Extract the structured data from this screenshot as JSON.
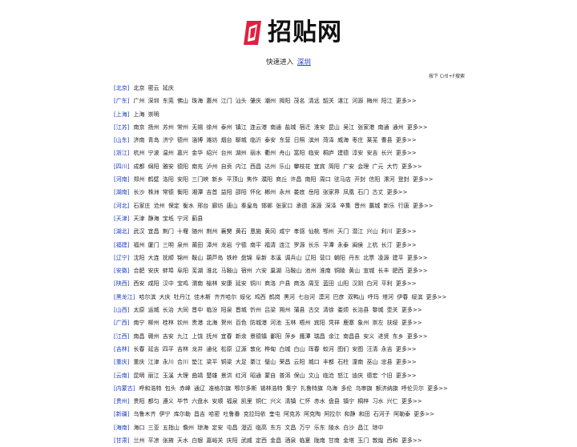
{
  "logo": {
    "text": "招贴网"
  },
  "quick": {
    "label": "快速进入",
    "city": "深圳"
  },
  "hint": "按下 Crtl+F搜索",
  "more": "更多>>",
  "regions": [
    {
      "name": "[北京]",
      "cities": [
        "北京",
        "密云",
        "延庆"
      ],
      "more": false
    },
    {
      "name": "[广东]",
      "cities": [
        "广州",
        "深圳",
        "东莞",
        "佛山",
        "珠海",
        "惠州",
        "江门",
        "汕头",
        "肇庆",
        "潮州",
        "揭阳",
        "茂名",
        "清远",
        "韶关",
        "湛江",
        "河源",
        "梅州",
        "阳江"
      ],
      "more": true
    },
    {
      "name": "[上海]",
      "cities": [
        "上海",
        "崇明"
      ],
      "more": false
    },
    {
      "name": "[江苏]",
      "cities": [
        "南京",
        "扬州",
        "苏州",
        "常州",
        "无锡",
        "徐州",
        "泰州",
        "镇江",
        "连云港",
        "南通",
        "盐城",
        "宿迁",
        "淮安",
        "昆山",
        "吴江",
        "张家港",
        "南通",
        "通州"
      ],
      "more": true
    },
    {
      "name": "[山东]",
      "cities": [
        "济南",
        "青岛",
        "济宁",
        "德州",
        "淄博",
        "潍坊",
        "烟台",
        "聊城",
        "临沂",
        "泰安",
        "东营",
        "日照",
        "滨州",
        "菏泽",
        "威海",
        "枣庄",
        "莱芜",
        "曹县"
      ],
      "more": true
    },
    {
      "name": "[浙江]",
      "cities": [
        "杭州",
        "宁波",
        "温州",
        "嘉兴",
        "金华",
        "绍兴",
        "台州",
        "湖州",
        "丽水",
        "衢州",
        "舟山",
        "富阳",
        "临安",
        "桐庐",
        "建德",
        "淳安",
        "安吉",
        "长兴"
      ],
      "more": true
    },
    {
      "name": "[四川]",
      "cities": [
        "成都",
        "绵阳",
        "雅安",
        "德阳",
        "南充",
        "泸州",
        "自贡",
        "内江",
        "西昌",
        "达州",
        "乐山",
        "攀枝花",
        "宜宾",
        "简阳",
        "广安",
        "会理",
        "广元",
        "大竹"
      ],
      "more": true
    },
    {
      "name": "[河南]",
      "cities": [
        "郑州",
        "鹤壁",
        "洛阳",
        "安阳",
        "三门峡",
        "新乡",
        "平顶山",
        "焦作",
        "濮阳",
        "商丘",
        "许昌",
        "南阳",
        "周口",
        "驻马店",
        "开封",
        "信阳",
        "漯河",
        "登封"
      ],
      "more": true
    },
    {
      "name": "[湖南]",
      "cities": [
        "长沙",
        "株洲",
        "常德",
        "衡阳",
        "湘潭",
        "吉首",
        "益阳",
        "邵阳",
        "怀化",
        "郴州",
        "永州",
        "娄底",
        "岳阳",
        "张家界",
        "凤凰",
        "石门",
        "古丈"
      ],
      "more": true
    },
    {
      "name": "[河北]",
      "cities": [
        "石家庄",
        "沧州",
        "保定",
        "衡水",
        "邢台",
        "廊坊",
        "唐山",
        "秦皇岛",
        "邯郸",
        "张家口",
        "承德",
        "涿源",
        "深泽",
        "辛集",
        "晋州",
        "藁城",
        "新乐",
        "行唐"
      ],
      "more": true
    },
    {
      "name": "[天津]",
      "cities": [
        "天津",
        "静海",
        "宝坻",
        "宁河",
        "蓟县"
      ],
      "more": false
    },
    {
      "name": "[湖北]",
      "cities": [
        "武汉",
        "宜昌",
        "荆门",
        "十堰",
        "随州",
        "荆州",
        "襄樊",
        "黄石",
        "恩施",
        "黄冈",
        "咸宁",
        "孝感",
        "仙桃",
        "鄂州",
        "天门",
        "潜江",
        "兴山",
        "利川"
      ],
      "more": true
    },
    {
      "name": "[福建]",
      "cities": [
        "福州",
        "厦门",
        "三明",
        "泉州",
        "莆田",
        "漳州",
        "龙岩",
        "宁德",
        "南平",
        "福清",
        "连江",
        "罗源",
        "长乐",
        "平潭",
        "永泰",
        "闽侯",
        "上杭",
        "长汀"
      ],
      "more": true
    },
    {
      "name": "[辽宁]",
      "cities": [
        "沈阳",
        "大连",
        "抚顺",
        "锦州",
        "鞍山",
        "葫芦岛",
        "铁岭",
        "盘锦",
        "阜新",
        "本溪",
        "调兵山",
        "辽阳",
        "营口",
        "朝阳",
        "丹东",
        "北票",
        "凌源",
        "建平"
      ],
      "more": true
    },
    {
      "name": "[安徽]",
      "cities": [
        "合肥",
        "安庆",
        "蚌埠",
        "阜阳",
        "芜湖",
        "淮北",
        "马鞍山",
        "宿州",
        "六安",
        "巢湖",
        "马鞍山",
        "池州",
        "淮南",
        "铜陵",
        "黄山",
        "宣城",
        "长丰",
        "肥西"
      ],
      "more": true
    },
    {
      "name": "[陕西]",
      "cities": [
        "西安",
        "咸阳",
        "汉中",
        "宝鸡",
        "渭南",
        "榆林",
        "安康",
        "延安",
        "铜川",
        "商洛",
        "户县",
        "商洛",
        "周至",
        "蓝田",
        "山阳",
        "汉阴",
        "白河",
        "平利"
      ],
      "more": true
    },
    {
      "name": "[黑龙江]",
      "cities": [
        "哈尔滨",
        "大庆",
        "牡丹江",
        "佳木斯",
        "齐齐哈尔",
        "绥化",
        "鸡西",
        "鹤岗",
        "黑河",
        "七台河",
        "漠河",
        "巴彦",
        "双鸭山",
        "呼玛",
        "塔河",
        "伊春",
        "绥滨"
      ],
      "more": true
    },
    {
      "name": "[山西]",
      "cities": [
        "太原",
        "运城",
        "长治",
        "大同",
        "晋中",
        "临汾",
        "阳泉",
        "晋城",
        "忻州",
        "吕梁",
        "朔州",
        "蒲县",
        "古交",
        "清徐",
        "娄烦",
        "长治县",
        "黎城",
        "壶关"
      ],
      "more": true
    },
    {
      "name": "[广西]",
      "cities": [
        "南宁",
        "柳州",
        "桂林",
        "钦州",
        "贵港",
        "北海",
        "贺州",
        "百色",
        "防城港",
        "河池",
        "玉林",
        "梧州",
        "宾阳",
        "凭祥",
        "鹿寨",
        "象州",
        "崇左",
        "扶绥"
      ],
      "more": true
    },
    {
      "name": "[江西]",
      "cities": [
        "南昌",
        "赣州",
        "吉安",
        "九江",
        "上饶",
        "抚州",
        "宜春",
        "新余",
        "景德镇",
        "鄱阳",
        "萍乡",
        "鹰潭",
        "瑞昌",
        "余江",
        "南昌县",
        "安义",
        "进贤",
        "东乡"
      ],
      "more": true
    },
    {
      "name": "[吉林]",
      "cities": [
        "长春",
        "延吉",
        "四平",
        "吉林",
        "龙井",
        "通化",
        "松原",
        "辽源",
        "敦化",
        "桦甸",
        "白城",
        "白山",
        "珲春",
        "蛟河",
        "图们",
        "安图",
        "汪清",
        "永吉"
      ],
      "more": true
    },
    {
      "name": "[重庆]",
      "cities": [
        "重庆",
        "江津",
        "永川",
        "合川",
        "垫江",
        "梁平",
        "铜梁",
        "大足",
        "綦江",
        "璧山",
        "荣昌",
        "云阳",
        "城口",
        "丰都",
        "石柱",
        "潼南",
        "巫山",
        "忠县"
      ],
      "more": true
    },
    {
      "name": "[云南]",
      "cities": [
        "昆明",
        "丽江",
        "玉溪",
        "大理",
        "曲靖",
        "楚雄",
        "景洪",
        "红河",
        "昭通",
        "蒙自",
        "普洱",
        "保山",
        "文山",
        "临沧",
        "怒江",
        "迪庆",
        "德宏",
        "个旧"
      ],
      "more": true
    },
    {
      "name": "[内蒙古]",
      "cities": [
        "呼和浩特",
        "包头",
        "赤峰",
        "通辽",
        "准格尔旗",
        "鄂尔多斯",
        "锡林浩特",
        "集宁",
        "扎鲁特旗",
        "乌海",
        "多伦",
        "乌审旗",
        "额济纳旗",
        "呼伦贝尔"
      ],
      "more": true
    },
    {
      "name": "[贵州]",
      "cities": [
        "贵阳",
        "都匀",
        "遵义",
        "毕节",
        "六盘水",
        "安顺",
        "福泉",
        "凯里",
        "铜仁",
        "兴义",
        "清镇",
        "仁怀",
        "赤水",
        "盘县",
        "镇宁",
        "桐梓",
        "习水",
        "兴仁"
      ],
      "more": true
    },
    {
      "name": "[新疆]",
      "cities": [
        "乌鲁木齐",
        "伊宁",
        "库尔勒",
        "昌吉",
        "哈密",
        "吐鲁番",
        "克拉玛依",
        "奎屯",
        "阿克苏",
        "阿克陶",
        "阿拉尔",
        "和静",
        "和田",
        "石河子",
        "阿勒泰"
      ],
      "more": true
    },
    {
      "name": "[海南]",
      "cities": [
        "海口",
        "三亚",
        "五指山",
        "儋州",
        "琼海",
        "定安",
        "屯昌",
        "澄迈",
        "临高",
        "东方",
        "文昌",
        "万宁",
        "乐东",
        "陵水",
        "白沙",
        "昌江",
        "琼中"
      ],
      "more": false
    },
    {
      "name": "[甘肃]",
      "cities": [
        "兰州",
        "平凉",
        "张掖",
        "天水",
        "白银",
        "嘉峪关",
        "庆阳",
        "武威",
        "定西",
        "金昌",
        "酒泉",
        "临夏",
        "陇南",
        "甘南",
        "金塔",
        "玉门",
        "敦煌",
        "西和"
      ],
      "more": true
    }
  ]
}
